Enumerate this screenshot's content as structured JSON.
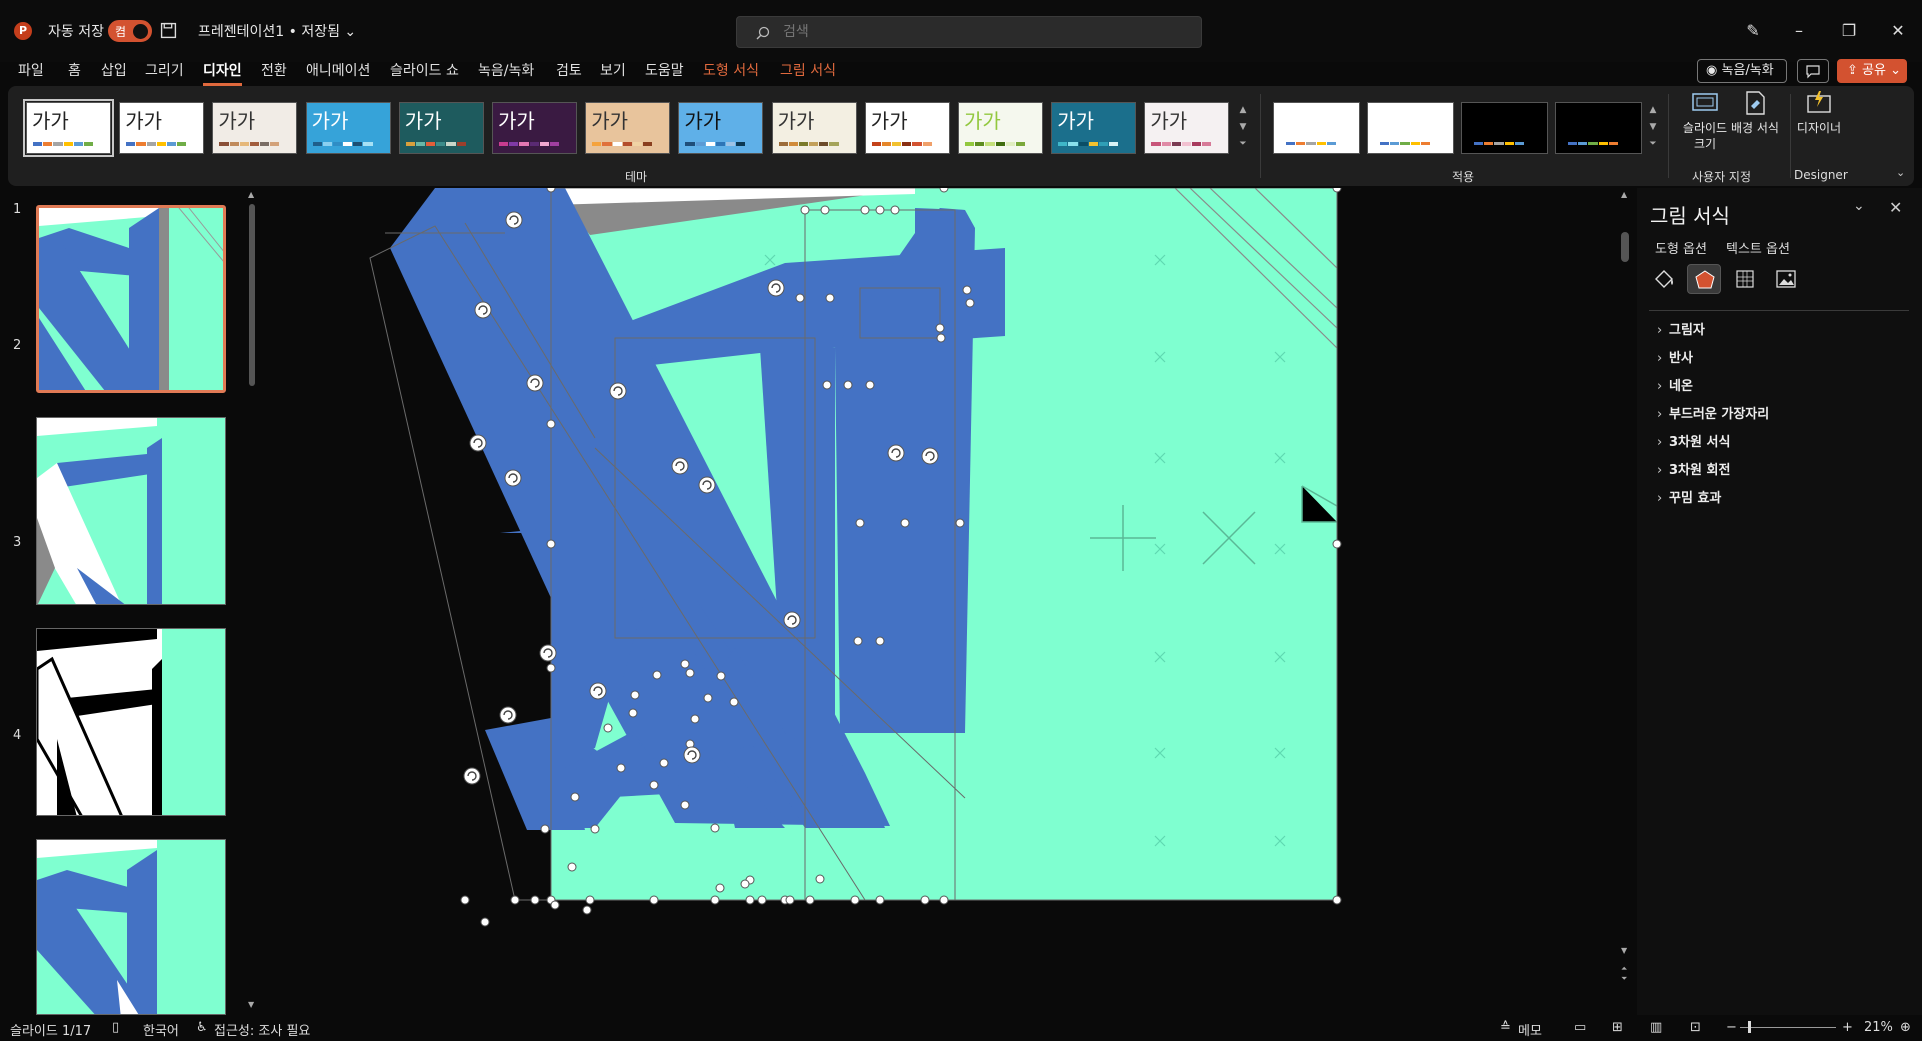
{
  "titlebar": {
    "autosave_label": "자동 저장",
    "autosave_state": "켬",
    "doc_title": "프레젠테이션1 • 저장됨 ⌄",
    "search_placeholder": "검색"
  },
  "tabs": [
    "파일",
    "홈",
    "삽입",
    "그리기",
    "디자인",
    "전환",
    "애니메이션",
    "슬라이드 쇼",
    "녹음/녹화",
    "검토",
    "보기",
    "도움말",
    "도형 서식",
    "그림 서식"
  ],
  "active_tab": "디자인",
  "actions": {
    "record": "녹음/녹화",
    "share": "공유"
  },
  "ribbon": {
    "theme_sample_text": "가가",
    "themes_group_label": "테마",
    "variants_group_label": "적용",
    "customize_group_label": "사용자 지정",
    "designer_group_label": "Designer",
    "slide_size_label": "슬라이드 크기",
    "bg_format_label": "배경 서식",
    "designer_label": "디자이너"
  },
  "themes": [
    {
      "bg": "#ffffff",
      "fg": "#222222",
      "bars": [
        "#4472c4",
        "#ed7d31",
        "#a5a5a5",
        "#ffc000",
        "#5b9bd5",
        "#70ad47"
      ]
    },
    {
      "bg": "#ffffff",
      "fg": "#222222",
      "bars": [
        "#4472c4",
        "#ed7d31",
        "#a5a5a5",
        "#ffc000",
        "#5b9bd5",
        "#70ad47"
      ]
    },
    {
      "bg": "#f1ece6",
      "fg": "#333333",
      "bars": [
        "#8a4f37",
        "#c08a5b",
        "#e6b87a",
        "#a25d3d",
        "#7a6d65",
        "#d3a27a"
      ]
    },
    {
      "bg": "#36a3d9",
      "fg": "#ffffff",
      "bars": [
        "#1f5f8b",
        "#8bd0f0",
        "#2f8dc5",
        "#ffffff",
        "#1c4f74",
        "#a6e1f5"
      ]
    },
    {
      "bg": "#1e5b5e",
      "fg": "#ffffff",
      "bars": [
        "#d8a03d",
        "#6ab7a7",
        "#e25f3a",
        "#3c8c8a",
        "#c8d6c9",
        "#9c3f2c"
      ]
    },
    {
      "bg": "#3a1a42",
      "fg": "#ffffff",
      "bars": [
        "#c83c8f",
        "#7f3aa6",
        "#e377b2",
        "#5a2a73",
        "#f0a7cf",
        "#a03fa0"
      ]
    },
    {
      "bg": "#e8c49c",
      "fg": "#333333",
      "bars": [
        "#f5a33c",
        "#e0713b",
        "#ffffff",
        "#b34d2c",
        "#f0d3a4",
        "#8a3f1f"
      ]
    },
    {
      "bg": "#5fb0e8",
      "fg": "#111111",
      "bars": [
        "#1f4e79",
        "#5b9bd5",
        "#ffffff",
        "#2e75b6",
        "#9dc3e6",
        "#0b3954"
      ]
    },
    {
      "bg": "#f3efe2",
      "fg": "#333333",
      "bars": [
        "#9c6c3a",
        "#d08b3a",
        "#7a7a2a",
        "#c2a05a",
        "#6b4b2a",
        "#a4a45a"
      ]
    },
    {
      "bg": "#ffffff",
      "fg": "#222222",
      "bars": [
        "#c4421a",
        "#e6862a",
        "#f2c12e",
        "#8a2f12",
        "#d35230",
        "#f0a06a"
      ]
    },
    {
      "bg": "#f5f8ee",
      "fg": "#92c83e",
      "bars": [
        "#92c83e",
        "#5d8c1f",
        "#c4e07a",
        "#3f6d0e",
        "#e0eec0",
        "#7aa83a"
      ]
    },
    {
      "bg": "#1b6f8c",
      "fg": "#ffffff",
      "bars": [
        "#3fb6c8",
        "#8ae0ec",
        "#0b4e66",
        "#f2c12e",
        "#2f9fb6",
        "#d8f2f6"
      ]
    },
    {
      "bg": "#f5f1f2",
      "fg": "#333333",
      "bars": [
        "#c8557a",
        "#e08aa6",
        "#7a3a52",
        "#f2c0d0",
        "#a83a5e",
        "#d77a98"
      ]
    }
  ],
  "variants": [
    {
      "bg": "#ffffff",
      "bars": [
        "#4472c4",
        "#ed7d31",
        "#a5a5a5",
        "#ffc000",
        "#5b9bd5"
      ]
    },
    {
      "bg": "#ffffff",
      "bars": [
        "#4472c4",
        "#5b9bd5",
        "#70ad47",
        "#ffc000",
        "#ed7d31"
      ]
    },
    {
      "bg": "#000000",
      "bars": [
        "#4472c4",
        "#ed7d31",
        "#a5a5a5",
        "#ffc000",
        "#5b9bd5"
      ]
    },
    {
      "bg": "#000000",
      "bars": [
        "#4472c4",
        "#5b9bd5",
        "#70ad47",
        "#ffc000",
        "#ed7d31"
      ]
    }
  ],
  "slides": [
    {
      "number": "1",
      "variant": "teal"
    },
    {
      "number": "2",
      "variant": "white"
    },
    {
      "number": "3",
      "variant": "black"
    },
    {
      "number": "4",
      "variant": "teal"
    }
  ],
  "format_pane": {
    "title": "그림 서식",
    "tab_shape": "도형 옵션",
    "tab_text": "텍스트 옵션",
    "sections": [
      "그림자",
      "반사",
      "네온",
      "부드러운 가장자리",
      "3차원 서식",
      "3차원 회전",
      "꾸밈 효과"
    ]
  },
  "status": {
    "slide_indicator": "슬라이드 1/17",
    "language": "한국어",
    "accessibility": "접근성: 조사 필요",
    "notes": "메모",
    "zoom": "21%"
  },
  "colors": {
    "accent": "#d35230",
    "slide_bg": "#7fffd0",
    "shape_blue": "#4472c4"
  }
}
